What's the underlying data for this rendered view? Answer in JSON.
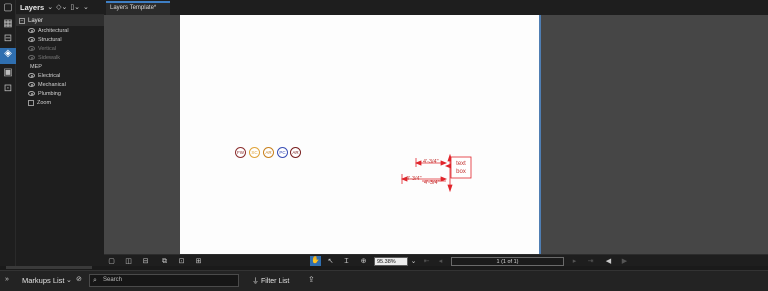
{
  "panel": {
    "title": "Layers",
    "root_label": "Layer",
    "layers": [
      {
        "label": "Architectural",
        "dim": false
      },
      {
        "label": "Structural",
        "dim": false
      },
      {
        "label": "Vertical",
        "dim": true
      },
      {
        "label": "Sidewalk",
        "dim": true
      }
    ],
    "group_label": "MEP",
    "group_layers": [
      {
        "label": "Electrical"
      },
      {
        "label": "Mechanical"
      },
      {
        "label": "Plumbing"
      }
    ],
    "zoom_layer": "Zoom"
  },
  "tab": {
    "label": "Layers Template*"
  },
  "canvas": {
    "stamps": [
      {
        "text": "FW",
        "color": "#8b2f2f"
      },
      {
        "text": "SC",
        "color": "#e0a43a"
      },
      {
        "text": "AR",
        "color": "#c8811e"
      },
      {
        "text": "PC",
        "color": "#3a4fb5"
      },
      {
        "text": "AR",
        "color": "#7a2020"
      }
    ],
    "markup_color": "#e0242b",
    "dimension_top": "4'-3/4\"",
    "dimension_bottom_left": "4'-3/4\"",
    "dimension_bottom_right": "4'-3/4\"",
    "text_box_line1": "text",
    "text_box_line2": "box"
  },
  "toolbar": {
    "zoom_value": "95.38%",
    "page_value": "1 (1 of 1)"
  },
  "markups": {
    "title": "Markups List",
    "search_placeholder": "Search",
    "filter_label": "Filter List"
  }
}
